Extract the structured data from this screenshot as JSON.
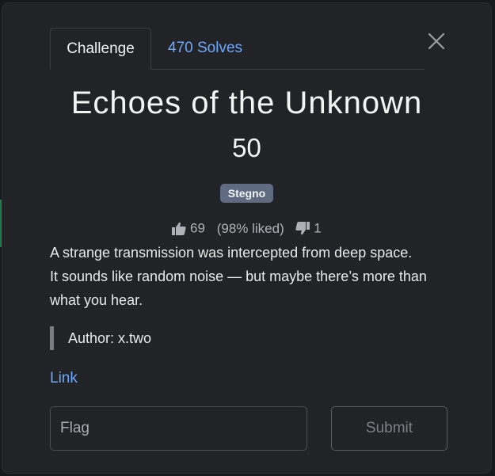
{
  "tabs": [
    {
      "label": "Challenge"
    },
    {
      "label": "470 Solves"
    }
  ],
  "challenge": {
    "title": "Echoes of the Unknown",
    "points": "50",
    "category": "Stegno",
    "likes": "69",
    "liked_percent": "(98% liked)",
    "dislikes": "1",
    "description": [
      "A strange transmission was intercepted from deep space.",
      "It sounds like random noise — but maybe there’s more than",
      "what you hear."
    ],
    "author": "Author: x.two",
    "link_label": "Link"
  },
  "form": {
    "flag_placeholder": "Flag",
    "flag_value": "",
    "submit_label": "Submit"
  },
  "colors": {
    "modal_bg": "#212327",
    "link": "#6ea8fe",
    "tag_bg": "#5e6b80"
  }
}
